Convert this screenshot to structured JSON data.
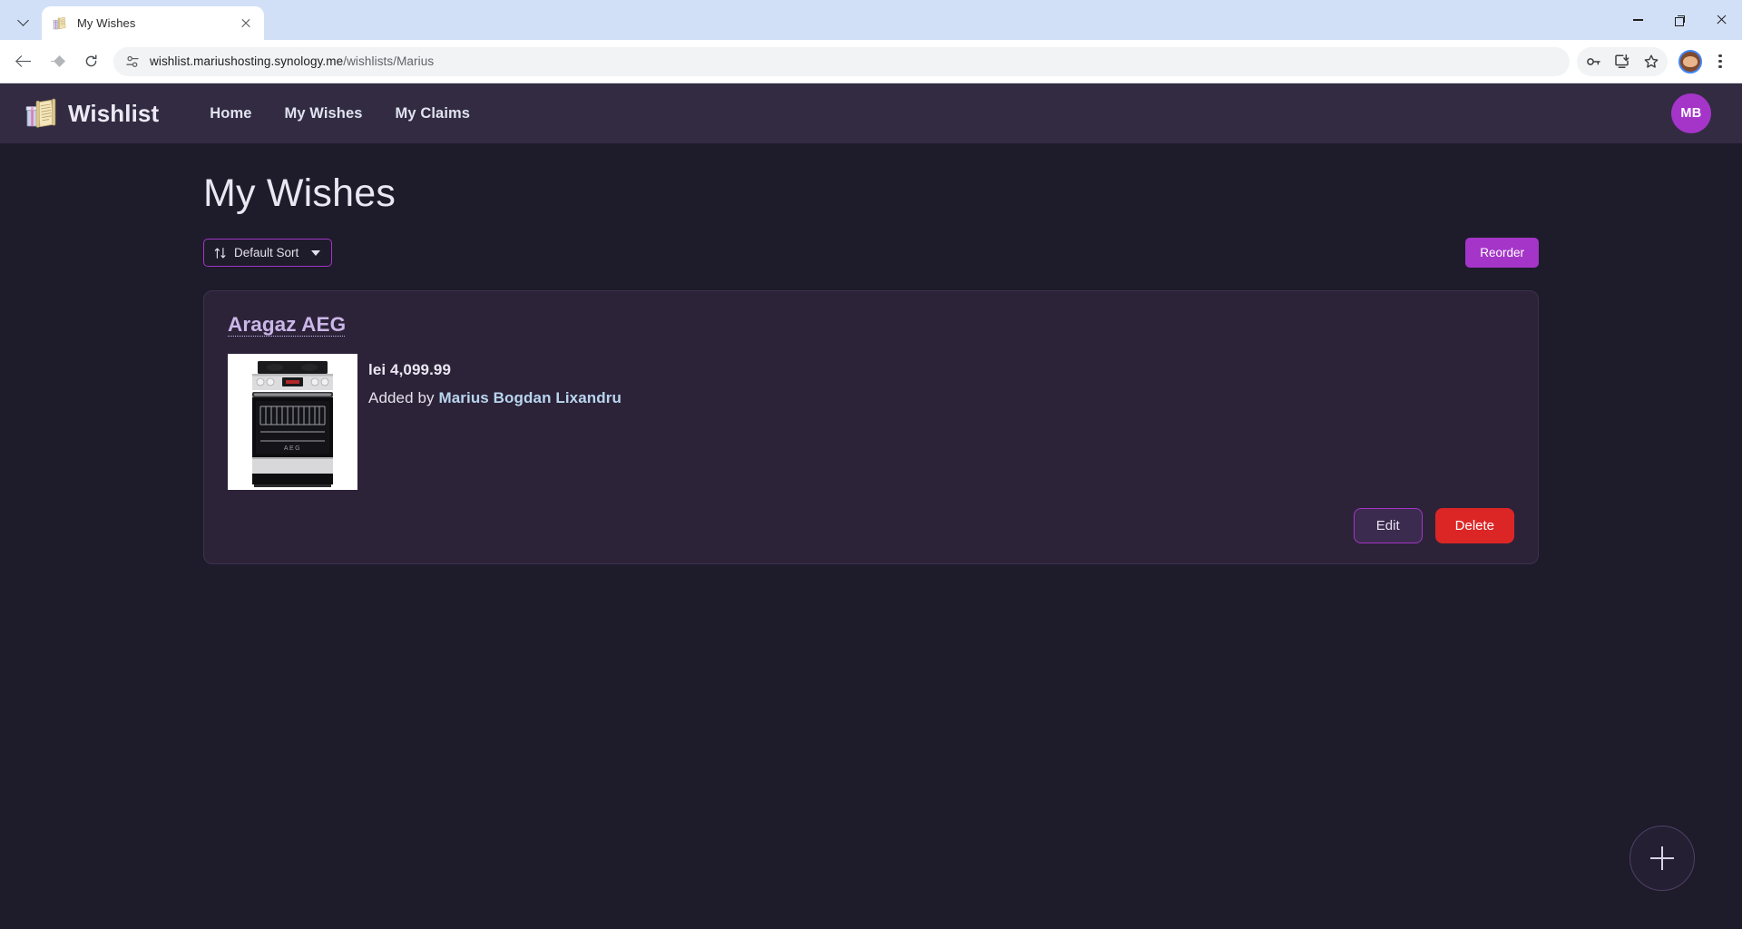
{
  "browser": {
    "tab": {
      "title": "My Wishes",
      "favicon": "scroll-gift-icon"
    },
    "tab_list_button": "tab-search-chevron",
    "nav": {
      "back": "back-arrow",
      "forward": "forward-arrow",
      "reload": "reload-icon"
    },
    "omnibox": {
      "site_settings_icon": "tune-icon",
      "url_host": "wishlist.mariushosting.synology.me",
      "url_path": "/wishlists/Marius",
      "url_full": "wishlist.mariushosting.synology.me/wishlists/Marius"
    },
    "toolbar_icons": [
      "password-key-icon",
      "install-app-icon",
      "bookmark-star-icon"
    ],
    "profile_avatar": "chrome-profile-avatar",
    "menu": "kebab-menu-icon",
    "window_controls": [
      "minimize",
      "maximize",
      "close"
    ]
  },
  "app": {
    "brand": {
      "name": "Wishlist",
      "icon": "scroll-gift-icon"
    },
    "nav_links": [
      {
        "label": "Home"
      },
      {
        "label": "My Wishes"
      },
      {
        "label": "My Claims"
      }
    ],
    "user_avatar": {
      "initials": "MB",
      "color": "#a435c8"
    }
  },
  "main": {
    "page_title": "My Wishes",
    "sort_button": {
      "label": "Default Sort",
      "icon": "sort-arrows-icon",
      "caret": "chevron-down-icon"
    },
    "reorder_button": {
      "label": "Reorder",
      "color": "#a435c8"
    }
  },
  "wishes": [
    {
      "title": "Aragaz AEG",
      "price": "lei 4,099.99",
      "added_by_prefix": "Added by",
      "added_by_name": "Marius Bogdan Lixandru",
      "image": "aeg-stainless-steel-cooker",
      "actions": {
        "edit": "Edit",
        "delete": "Delete"
      }
    }
  ],
  "fab": {
    "label": "+",
    "name": "add-wish-button"
  },
  "colors": {
    "page_bg": "#1e1b2a",
    "nav_bg": "#322b42",
    "card_bg": "#2c2339",
    "accent": "#a435c8",
    "danger": "#dc2626",
    "title_link": "#cbb6e8"
  }
}
